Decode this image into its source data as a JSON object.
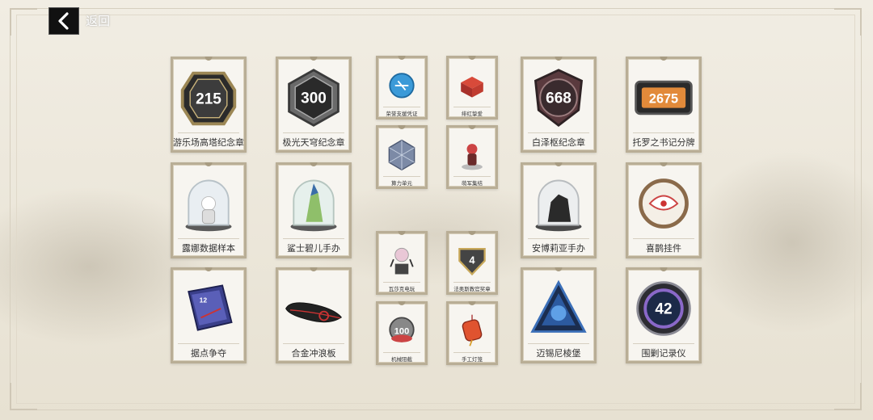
{
  "nav": {
    "back_label": "返回"
  },
  "large_items": [
    {
      "label": "游乐场高塔纪念章",
      "badge": "215"
    },
    {
      "label": "极光天穹纪念章",
      "badge": "300"
    },
    {
      "label": "白泽枢纪念章",
      "badge": "668"
    },
    {
      "label": "托罗之书记分牌",
      "badge": "2675"
    },
    {
      "label": "露娜数据样本"
    },
    {
      "label": "鲨士碧儿手办"
    },
    {
      "label": "安博莉亚手办"
    },
    {
      "label": "喜鹊挂件"
    },
    {
      "label": "据点争夺"
    },
    {
      "label": "合金冲浪板"
    },
    {
      "label": "迈锡尼棱堡"
    },
    {
      "label": "围剿记录仪",
      "badge": "42"
    }
  ],
  "small_items": [
    {
      "label": "荣誉支援凭证"
    },
    {
      "label": "绯红挚爱"
    },
    {
      "label": "算力单元"
    },
    {
      "label": "萌军集结"
    },
    {
      "label": "瓦莎克电玩"
    },
    {
      "label": "法奥斯教官奖章",
      "badge": "4"
    },
    {
      "label": "机械阻截",
      "badge": "100"
    },
    {
      "label": "手工灯笼"
    }
  ]
}
